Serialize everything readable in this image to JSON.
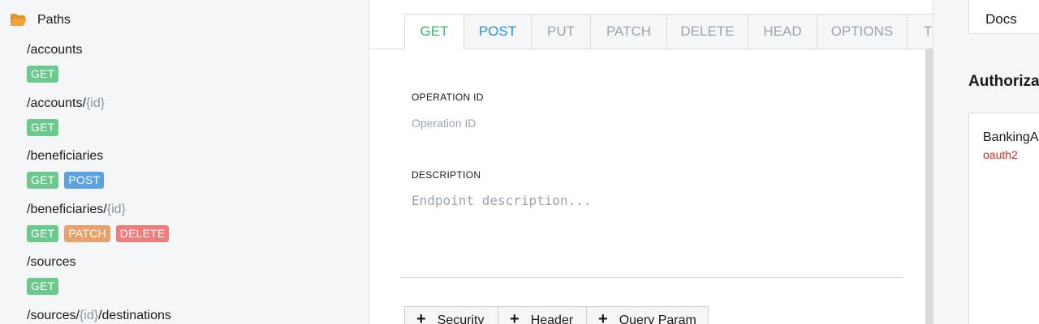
{
  "sidebar": {
    "header": "Paths",
    "paths": [
      {
        "segments": [
          {
            "text": "/accounts",
            "param": false
          }
        ],
        "methods": [
          "GET"
        ]
      },
      {
        "segments": [
          {
            "text": "/accounts/",
            "param": false
          },
          {
            "text": "{id}",
            "param": true
          }
        ],
        "methods": [
          "GET"
        ]
      },
      {
        "segments": [
          {
            "text": "/beneficiaries",
            "param": false
          }
        ],
        "methods": [
          "GET",
          "POST"
        ]
      },
      {
        "segments": [
          {
            "text": "/beneficiaries/",
            "param": false
          },
          {
            "text": "{id}",
            "param": true
          }
        ],
        "methods": [
          "GET",
          "PATCH",
          "DELETE"
        ]
      },
      {
        "segments": [
          {
            "text": "/sources",
            "param": false
          }
        ],
        "methods": [
          "GET"
        ]
      },
      {
        "segments": [
          {
            "text": "/sources/",
            "param": false
          },
          {
            "text": "{id}",
            "param": true
          },
          {
            "text": "/destinations",
            "param": false
          }
        ],
        "methods": []
      }
    ]
  },
  "main": {
    "tabs": [
      "GET",
      "POST",
      "PUT",
      "PATCH",
      "DELETE",
      "HEAD",
      "OPTIONS",
      "T"
    ],
    "active_tab": "GET",
    "operation_id_label": "OPERATION ID",
    "operation_id_placeholder": "Operation ID",
    "operation_id_value": "",
    "description_label": "DESCRIPTION",
    "description_placeholder": "Endpoint description...",
    "description_value": "",
    "add_buttons": [
      "Security",
      "Header",
      "Query Param"
    ]
  },
  "right": {
    "tab": "Docs",
    "heading": "Authorizat",
    "auth_name": "BankingA",
    "auth_type": "oauth2"
  },
  "colors": {
    "get": "#6cc98d",
    "post": "#5aa2e2",
    "patch": "#e8a16a",
    "delete": "#ee7d7d",
    "active_tab_text": "#36b76a",
    "post_tab_text": "#2b8fd6",
    "oauth_text": "#cc2b2b",
    "folder_icon": "#f0a33a"
  },
  "icons": {
    "paths_header": "folder-open-icon",
    "add_button": "plus-icon"
  }
}
